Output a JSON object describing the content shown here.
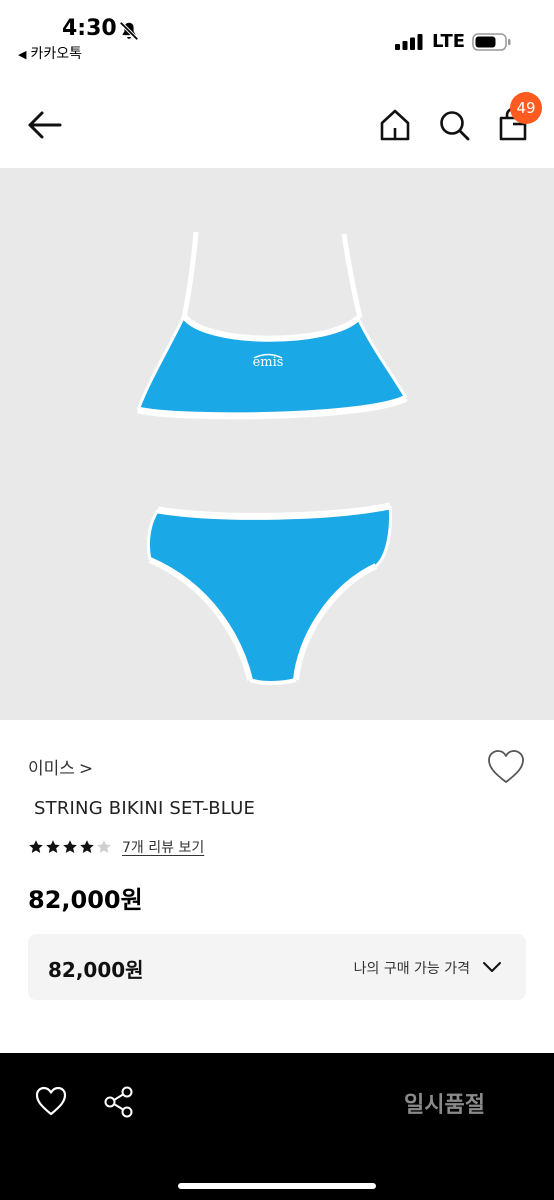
{
  "status_bar": {
    "time": "4:30",
    "back_app": "카카오톡",
    "network": "LTE"
  },
  "nav": {
    "cart_count": "49",
    "icons": [
      "back-arrow-icon",
      "home-icon",
      "search-icon",
      "bag-icon"
    ]
  },
  "product": {
    "image_logo_text": "emis",
    "brand": "이미스",
    "brand_chevron": ">",
    "name": "STRING BIKINI SET-BLUE",
    "rating": 4,
    "rating_max": 5,
    "review_link": "7개 리뷰 보기",
    "price": "82,000원",
    "price_box": {
      "value": "82,000원",
      "label": "나의 구매 가능 가격"
    }
  },
  "bottom_bar": {
    "soldout_label": "일시품절",
    "icons": [
      "heart-icon",
      "share-icon"
    ]
  },
  "colors": {
    "badge": "#ff5a1f",
    "swim_blue": "#1aa8e6",
    "bottom_bar_bg": "#000000",
    "soldout_text": "#8a8a8a"
  }
}
